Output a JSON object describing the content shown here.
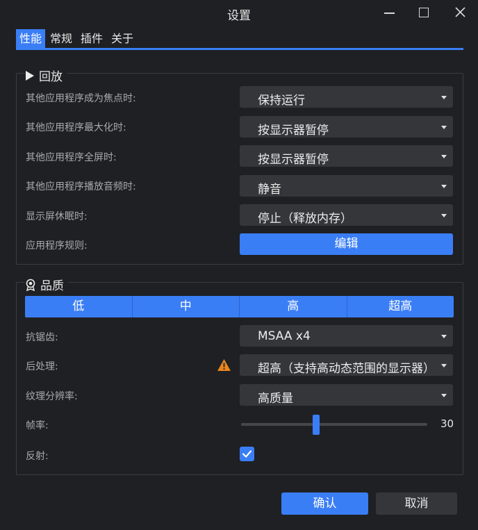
{
  "window": {
    "title": "设置"
  },
  "tabs": [
    {
      "label": "性能",
      "active": true
    },
    {
      "label": "常规",
      "active": false
    },
    {
      "label": "插件",
      "active": false
    },
    {
      "label": "关于",
      "active": false
    }
  ],
  "playback": {
    "title": "回放",
    "rows": [
      {
        "label": "其他应用程序成为焦点时:",
        "value": "保持运行"
      },
      {
        "label": "其他应用程序最大化时:",
        "value": "按显示器暂停"
      },
      {
        "label": "其他应用程序全屏时:",
        "value": "按显示器暂停"
      },
      {
        "label": "其他应用程序播放音频时:",
        "value": "静音"
      },
      {
        "label": "显示屏休眠时:",
        "value": "停止（释放内存）"
      }
    ],
    "rules": {
      "label": "应用程序规则:",
      "button": "编辑"
    }
  },
  "quality": {
    "title": "品质",
    "presets": [
      "低",
      "中",
      "高",
      "超高"
    ],
    "antialiasing": {
      "label": "抗锯齿:",
      "value": "MSAA x4"
    },
    "postprocess": {
      "label": "后处理:",
      "value": "超高（支持高动态范围的显示器）"
    },
    "texture": {
      "label": "纹理分辨率:",
      "value": "高质量"
    },
    "framerate": {
      "label": "帧率:",
      "value": "30"
    },
    "reflection": {
      "label": "反射:",
      "checked": true
    }
  },
  "footer": {
    "ok": "确认",
    "cancel": "取消"
  },
  "colors": {
    "accent": "#3a7ef5",
    "background": "#1f2023",
    "warning": "#e8851e"
  }
}
